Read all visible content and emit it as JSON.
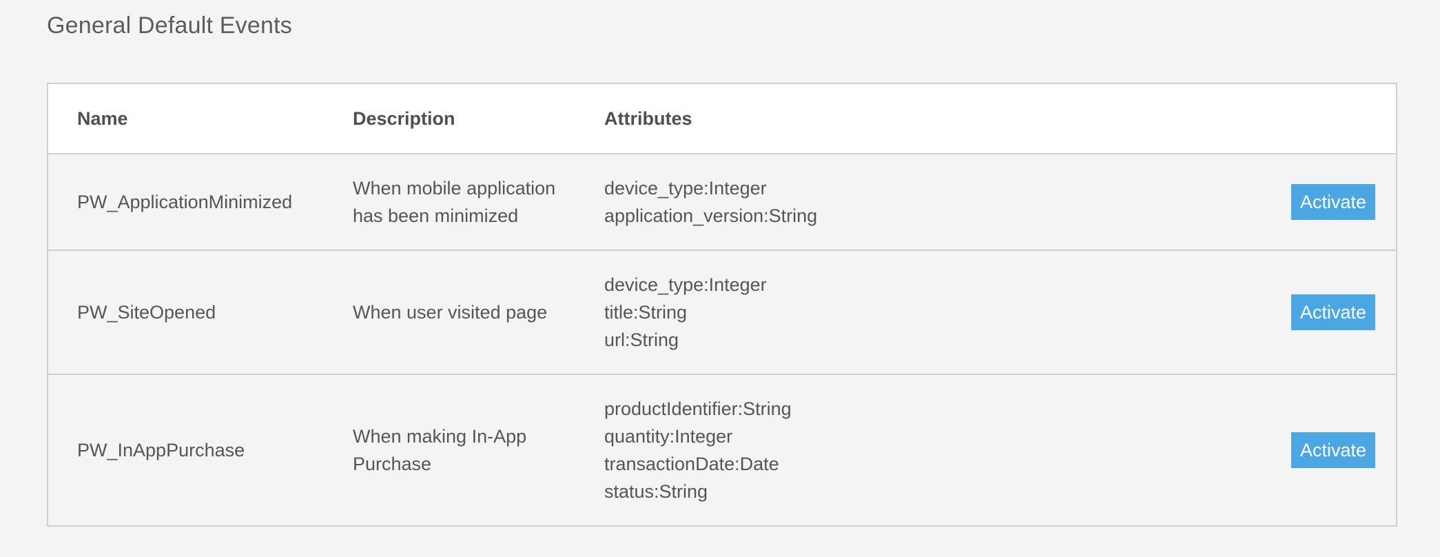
{
  "section": {
    "title": "General Default Events"
  },
  "table": {
    "columns": {
      "name": "Name",
      "description": "Description",
      "attributes": "Attributes"
    },
    "rows": [
      {
        "name": "PW_ApplicationMinimized",
        "description": "When mobile application has been minimized",
        "attributes": [
          "device_type:Integer",
          "application_version:String"
        ],
        "action_label": "Activate"
      },
      {
        "name": "PW_SiteOpened",
        "description": "When user visited page",
        "attributes": [
          "device_type:Integer",
          "title:String",
          "url:String"
        ],
        "action_label": "Activate"
      },
      {
        "name": "PW_InAppPurchase",
        "description": "When making In-App Purchase",
        "attributes": [
          "productIdentifier:String",
          "quantity:Integer",
          "transactionDate:Date",
          "status:String"
        ],
        "action_label": "Activate"
      }
    ]
  },
  "colors": {
    "background": "#f4f4f4",
    "header_background": "#ffffff",
    "border": "#d0d0d0",
    "button": "#4aa7e4",
    "button_text": "#ffffff",
    "text": "#555555"
  }
}
